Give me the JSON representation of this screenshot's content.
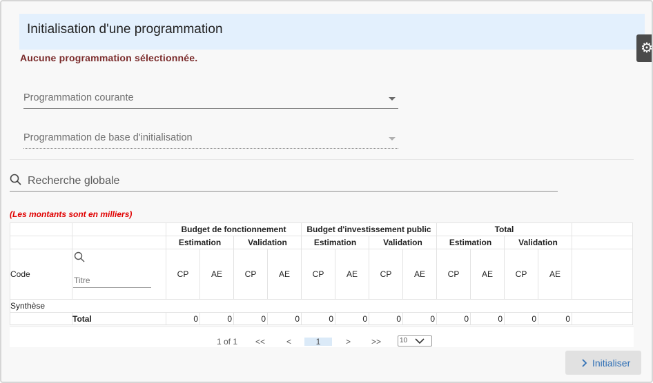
{
  "page": {
    "title": "Initialisation d'une programmation",
    "warning": "Aucune programmation sélectionnée."
  },
  "filters": {
    "current_program_label": "Programmation courante",
    "base_program_label": "Programmation de base d'initialisation"
  },
  "search": {
    "placeholder": "Recherche globale"
  },
  "note": "(Les montants sont en milliers)",
  "table": {
    "groups": [
      "Budget de fonctionnement",
      "Budget d'investissement public",
      "Total"
    ],
    "subgroups": [
      "Estimation",
      "Validation",
      "Estimation",
      "Validation",
      "Estimation",
      "Validation"
    ],
    "leaf": [
      "CP",
      "AE",
      "CP",
      "AE",
      "CP",
      "AE",
      "CP",
      "AE",
      "CP",
      "AE",
      "CP",
      "AE"
    ],
    "code_header": "Code",
    "title_placeholder": "Titre",
    "synthese_label": "Synthèse",
    "total_label": "Total",
    "total_values": [
      "0",
      "0",
      "0",
      "0",
      "0",
      "0",
      "0",
      "0",
      "0",
      "0",
      "0",
      "0"
    ]
  },
  "pager": {
    "range": "1 of 1",
    "first": "<<",
    "prev": "<",
    "current": "1",
    "next": ">",
    "last": ">>",
    "page_size": "10"
  },
  "actions": {
    "initialize": "Initialiser"
  },
  "icons": {
    "gear": "gear-icon",
    "search": "search-icon",
    "chevron_right": "chevron-right-icon"
  },
  "colors": {
    "header_bg": "#e3f0fd",
    "warning": "#7a2b2b",
    "note": "#e00000",
    "accent": "#2f6fb5"
  }
}
